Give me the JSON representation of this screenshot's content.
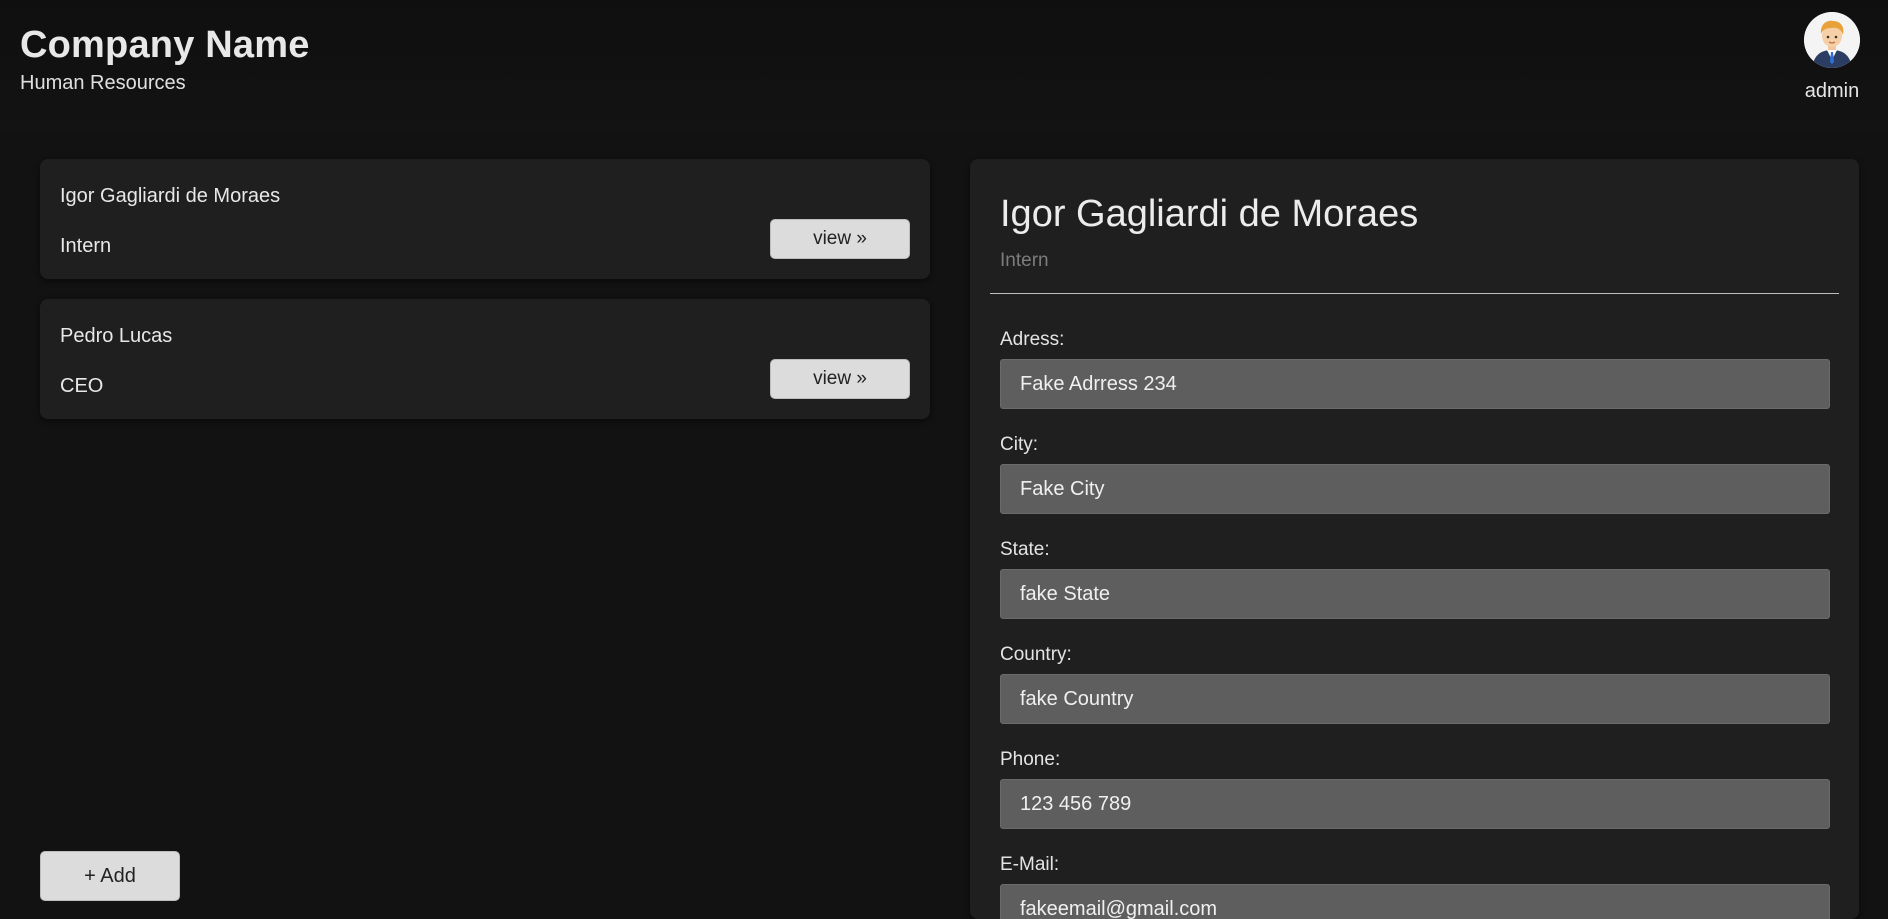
{
  "header": {
    "company_name": "Company Name",
    "department": "Human Resources",
    "user": {
      "name": "admin",
      "avatar_icon": "user-avatar-icon"
    }
  },
  "employees": [
    {
      "name": "Igor Gagliardi de Moraes",
      "role": "Intern",
      "button_label": "view »"
    },
    {
      "name": "Pedro Lucas",
      "role": "CEO",
      "button_label": "view »"
    }
  ],
  "add_button_label": "+ Add",
  "detail": {
    "name": "Igor Gagliardi de Moraes",
    "role": "Intern",
    "fields": [
      {
        "label": "Adress:",
        "value": "Fake Adrress 234"
      },
      {
        "label": "City:",
        "value": "Fake City"
      },
      {
        "label": "State:",
        "value": "fake State"
      },
      {
        "label": "Country:",
        "value": "fake Country"
      },
      {
        "label": "Phone:",
        "value": "123 456 789"
      },
      {
        "label": "E-Mail:",
        "value": "fakeemail@gmail.com"
      }
    ]
  },
  "colors": {
    "background": "#121212",
    "card": "#1f1f1f",
    "input": "#5e5e5e",
    "button": "#dcdcdc",
    "muted_text": "#7c7c7c"
  }
}
